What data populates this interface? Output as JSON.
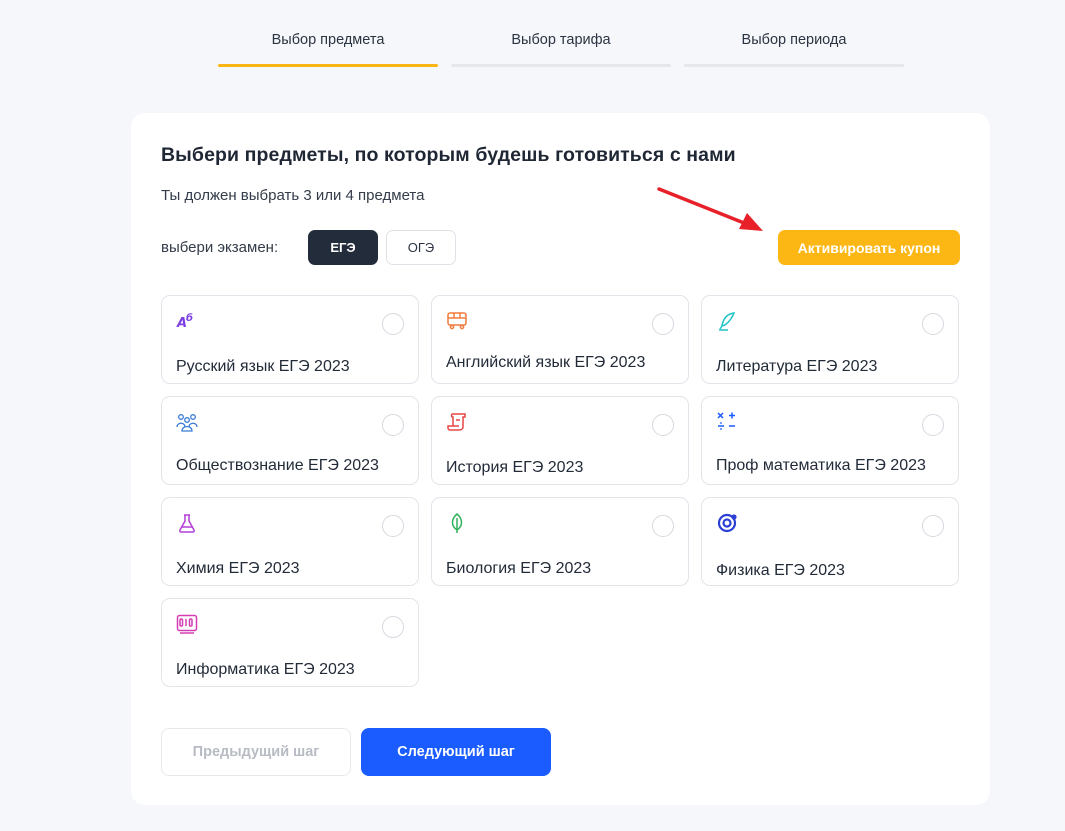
{
  "steps": [
    {
      "label": "Выбор предмета",
      "active": true
    },
    {
      "label": "Выбор тарифа",
      "active": false
    },
    {
      "label": "Выбор периода",
      "active": false
    }
  ],
  "card": {
    "title": "Выбери предметы, по которым будешь готовиться с нами",
    "subtitle": "Ты должен выбрать 3 или 4 предмета",
    "exam_label": "выбери экзамен:",
    "exam_options": [
      "ЕГЭ",
      "ОГЭ"
    ],
    "selected_exam": "ЕГЭ",
    "coupon_button": "Активировать купон"
  },
  "subjects": [
    {
      "name": "Русский язык ЕГЭ 2023",
      "icon": "letters-icon",
      "color": "#7b3fe4"
    },
    {
      "name": "Английский язык ЕГЭ 2023",
      "icon": "bus-icon",
      "color": "#f07b3f"
    },
    {
      "name": "Литература ЕГЭ 2023",
      "icon": "quill-icon",
      "color": "#1ec3c7"
    },
    {
      "name": "Обществознание ЕГЭ 2023",
      "icon": "people-icon",
      "color": "#3a7bd5"
    },
    {
      "name": "История ЕГЭ 2023",
      "icon": "scroll-icon",
      "color": "#e84545"
    },
    {
      "name": "Проф математика ЕГЭ 2023",
      "icon": "math-icon",
      "color": "#1a5cff"
    },
    {
      "name": "Химия ЕГЭ 2023",
      "icon": "flask-icon",
      "color": "#b23fd6"
    },
    {
      "name": "Биология ЕГЭ 2023",
      "icon": "leaf-icon",
      "color": "#2fb35a"
    },
    {
      "name": "Физика ЕГЭ 2023",
      "icon": "atom-icon",
      "color": "#2b3fd6"
    },
    {
      "name": "Информатика ЕГЭ 2023",
      "icon": "binary-icon",
      "color": "#d63fb3"
    }
  ],
  "buttons": {
    "prev": "Предыдущий шаг",
    "next": "Следующий шаг"
  },
  "colors": {
    "accent": "#fdb714",
    "primary": "#1a5cff",
    "dark": "#232c3b",
    "annotation_arrow": "#e8202a"
  }
}
